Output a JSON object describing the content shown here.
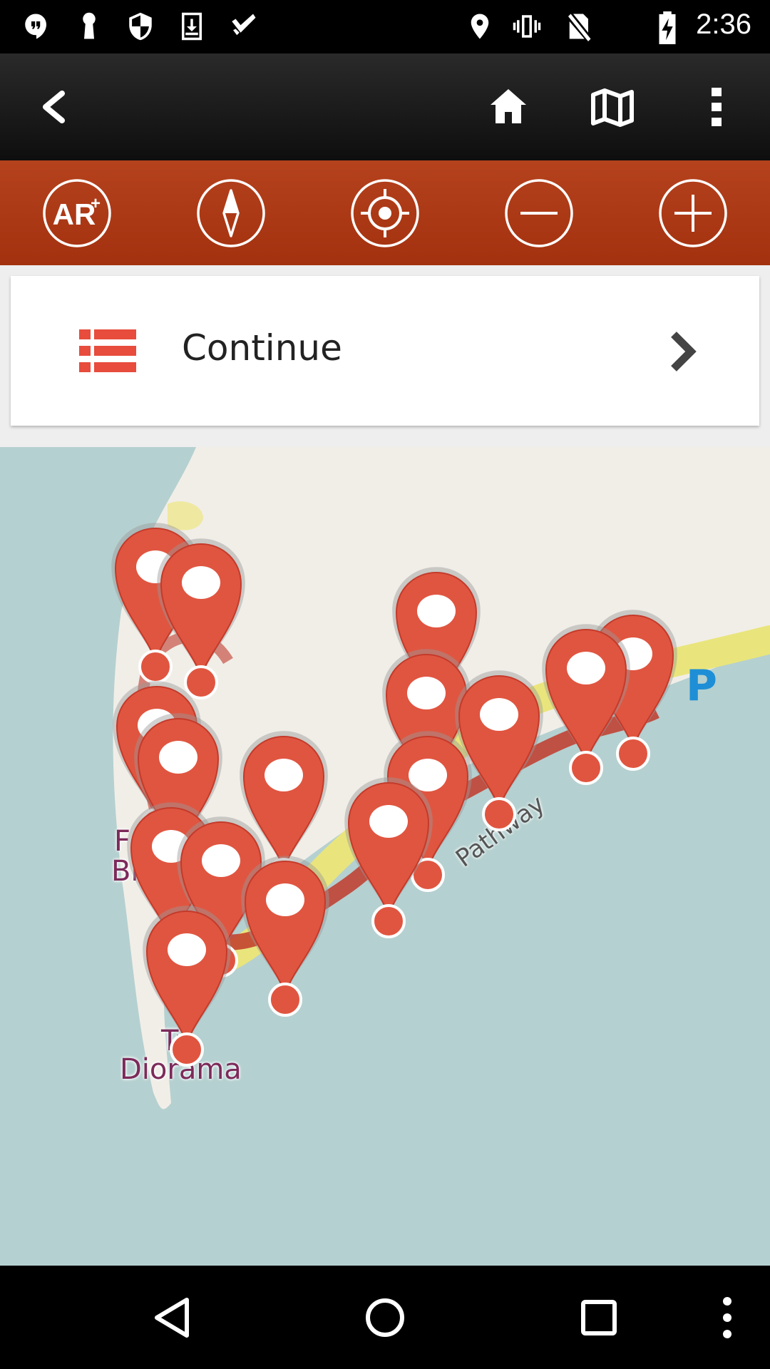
{
  "status_bar": {
    "time": "2:36",
    "left_icons": [
      "hangouts-icon",
      "keyhole-icon",
      "shield-icon",
      "download-icon",
      "check-icon"
    ],
    "right_icons": [
      "location-icon",
      "vibrate-icon",
      "no-sim-icon",
      "battery-charging-icon"
    ]
  },
  "app_bar": {
    "back_icon": "back-arrow-icon",
    "actions": [
      "home-icon",
      "map-icon",
      "more-vert-icon"
    ]
  },
  "toolbar": {
    "buttons": [
      {
        "name": "ar-button",
        "label": "AR+"
      },
      {
        "name": "compass-button",
        "icon": "compass-icon"
      },
      {
        "name": "locate-button",
        "icon": "target-icon"
      },
      {
        "name": "zoom-out-button",
        "icon": "minus-icon"
      },
      {
        "name": "zoom-in-button",
        "icon": "plus-icon"
      }
    ]
  },
  "continue_card": {
    "label": "Continue",
    "icon": "list-icon",
    "chevron": "chevron-right-icon",
    "accent": "#e74c3c"
  },
  "map": {
    "labels": {
      "pathway": "Pathway",
      "parking": "P",
      "fort_line1": "Fo",
      "fort_line2": "Bl",
      "diorama_line1": "Tr",
      "diorama_line2": "Diorama"
    },
    "pin_color": "#e05540",
    "water_color": "#b5d0d0",
    "land_color": "#f1eee8"
  },
  "nav_bar": {
    "buttons": [
      "back-triangle-icon",
      "home-circle-icon",
      "recents-square-icon",
      "overflow-icon"
    ]
  }
}
